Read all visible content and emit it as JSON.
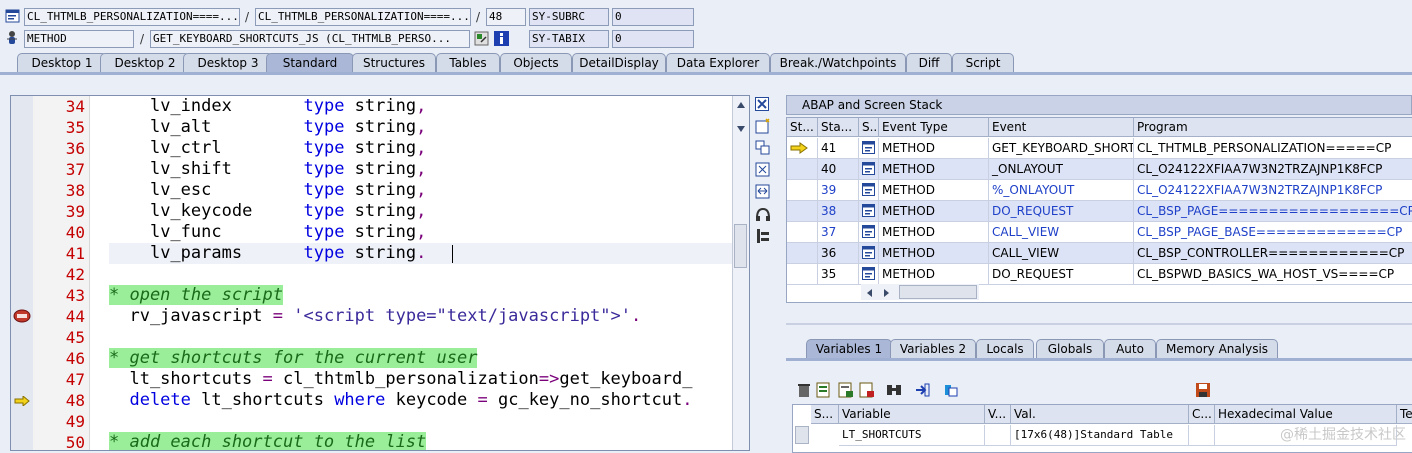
{
  "header": {
    "row1": {
      "class_field": "CL_THTMLB_PERSONALIZATION====...",
      "class_field2": "CL_THTMLB_PERSONALIZATION====...",
      "line_field": "48",
      "sysvar": "SY-SUBRC",
      "sysvar_value": "0"
    },
    "row2": {
      "type_field": "METHOD",
      "method_field": "GET_KEYBOARD_SHORTCUTS_JS (CL_THTMLB_PERSO...",
      "sysvar": "SY-TABIX",
      "sysvar_value": "0"
    },
    "slash": "/"
  },
  "tabs": [
    {
      "label": "Desktop 1"
    },
    {
      "label": "Desktop 2"
    },
    {
      "label": "Desktop 3"
    },
    {
      "label": "Standard"
    },
    {
      "label": "Structures"
    },
    {
      "label": "Tables"
    },
    {
      "label": "Objects"
    },
    {
      "label": "DetailDisplay"
    },
    {
      "label": "Data Explorer"
    },
    {
      "label": "Break./Watchpoints"
    },
    {
      "label": "Diff"
    },
    {
      "label": "Script"
    }
  ],
  "editor": {
    "line_numbers": [
      "34",
      "35",
      "36",
      "37",
      "38",
      "39",
      "40",
      "41",
      "42",
      "43",
      "44",
      "45",
      "46",
      "47",
      "48",
      "49",
      "50"
    ],
    "lines": [
      {
        "indent": "    ",
        "name": "lv_index       ",
        "kw": "type",
        "rest": " string",
        "end": ","
      },
      {
        "indent": "    ",
        "name": "lv_alt         ",
        "kw": "type",
        "rest": " string",
        "end": ","
      },
      {
        "indent": "    ",
        "name": "lv_ctrl        ",
        "kw": "type",
        "rest": " string",
        "end": ","
      },
      {
        "indent": "    ",
        "name": "lv_shift       ",
        "kw": "type",
        "rest": " string",
        "end": ","
      },
      {
        "indent": "    ",
        "name": "lv_esc         ",
        "kw": "type",
        "rest": " string",
        "end": ","
      },
      {
        "indent": "    ",
        "name": "lv_keycode     ",
        "kw": "type",
        "rest": " string",
        "end": ","
      },
      {
        "indent": "    ",
        "name": "lv_func        ",
        "kw": "type",
        "rest": " string",
        "end": ","
      },
      {
        "indent": "    ",
        "name": "lv_params      ",
        "kw": "type",
        "rest": " string",
        "end": "."
      }
    ],
    "comment1": "* open the script",
    "line44_a": "  rv_javascript ",
    "line44_eq": "=",
    "line44_str": " '<script type=\"text/javascript\">'",
    "line44_end": ".",
    "comment2": "* get shortcuts for the current user",
    "line47_a": "  lt_shortcuts ",
    "line47_eq": "=",
    "line47_b": " cl_thtmlb_personalization",
    "line47_arrow": "=>",
    "line47_c": "get_keyboard_",
    "line48_kw1": "  delete",
    "line48_a": " lt_shortcuts ",
    "line48_kw2": "where",
    "line48_b": " keycode ",
    "line48_eq": "=",
    "line48_c": " gc_key_no_shortcut",
    "line48_end": ".",
    "comment3": "* add each shortcut to the list"
  },
  "stack": {
    "title": "ABAP and Screen Stack",
    "columns": [
      "St...",
      "Sta...",
      "S...",
      "Event Type",
      "Event",
      "Program"
    ],
    "rows": [
      {
        "level": "41",
        "etype": "METHOD",
        "event": "GET_KEYBOARD_SHORT...",
        "program": "CL_THTMLB_PERSONALIZATION=====CP",
        "current": true,
        "blue": false
      },
      {
        "level": "40",
        "etype": "METHOD",
        "event": "_ONLAYOUT",
        "program": "CL_O24122XFIAA7W3N2TRZAJNP1K8FCP",
        "current": false,
        "blue": false
      },
      {
        "level": "39",
        "etype": "METHOD",
        "event": "%_ONLAYOUT",
        "program": "CL_O24122XFIAA7W3N2TRZAJNP1K8FCP",
        "current": false,
        "blue": true
      },
      {
        "level": "38",
        "etype": "METHOD",
        "event": "DO_REQUEST",
        "program": "CL_BSP_PAGE==================CP",
        "current": false,
        "blue": true
      },
      {
        "level": "37",
        "etype": "METHOD",
        "event": "CALL_VIEW",
        "program": "CL_BSP_PAGE_BASE=============CP",
        "current": false,
        "blue": true
      },
      {
        "level": "36",
        "etype": "METHOD",
        "event": "CALL_VIEW",
        "program": "CL_BSP_CONTROLLER============CP",
        "current": false,
        "blue": false
      },
      {
        "level": "35",
        "etype": "METHOD",
        "event": "DO_REQUEST",
        "program": "CL_BSPWD_BASICS_WA_HOST_VS====CP",
        "current": false,
        "blue": false
      }
    ]
  },
  "var_tabs": [
    {
      "label": "Variables 1"
    },
    {
      "label": "Variables 2"
    },
    {
      "label": "Locals"
    },
    {
      "label": "Globals"
    },
    {
      "label": "Auto"
    },
    {
      "label": "Memory Analysis"
    }
  ],
  "variables": {
    "columns": [
      "S...",
      "Variable",
      "V...",
      "Val.",
      "C...",
      "Hexadecimal Value",
      "Te"
    ],
    "rows": [
      {
        "variable": "LT_SHORTCUTS",
        "value": "[17x6(48)]Standard Table"
      }
    ]
  },
  "watermark": "@稀土掘金技术社区",
  "icons": {
    "header_row1": "screen-icon",
    "header_row2": "debug-method-icon",
    "navigate": "display-object-icon",
    "info": "info-icon"
  },
  "colors": {
    "background": "#e9eef7",
    "keyword": "#0000e0",
    "line_number": "#c40000",
    "comment_bg": "#9aee9a",
    "active_tab": "#aab7d6"
  }
}
